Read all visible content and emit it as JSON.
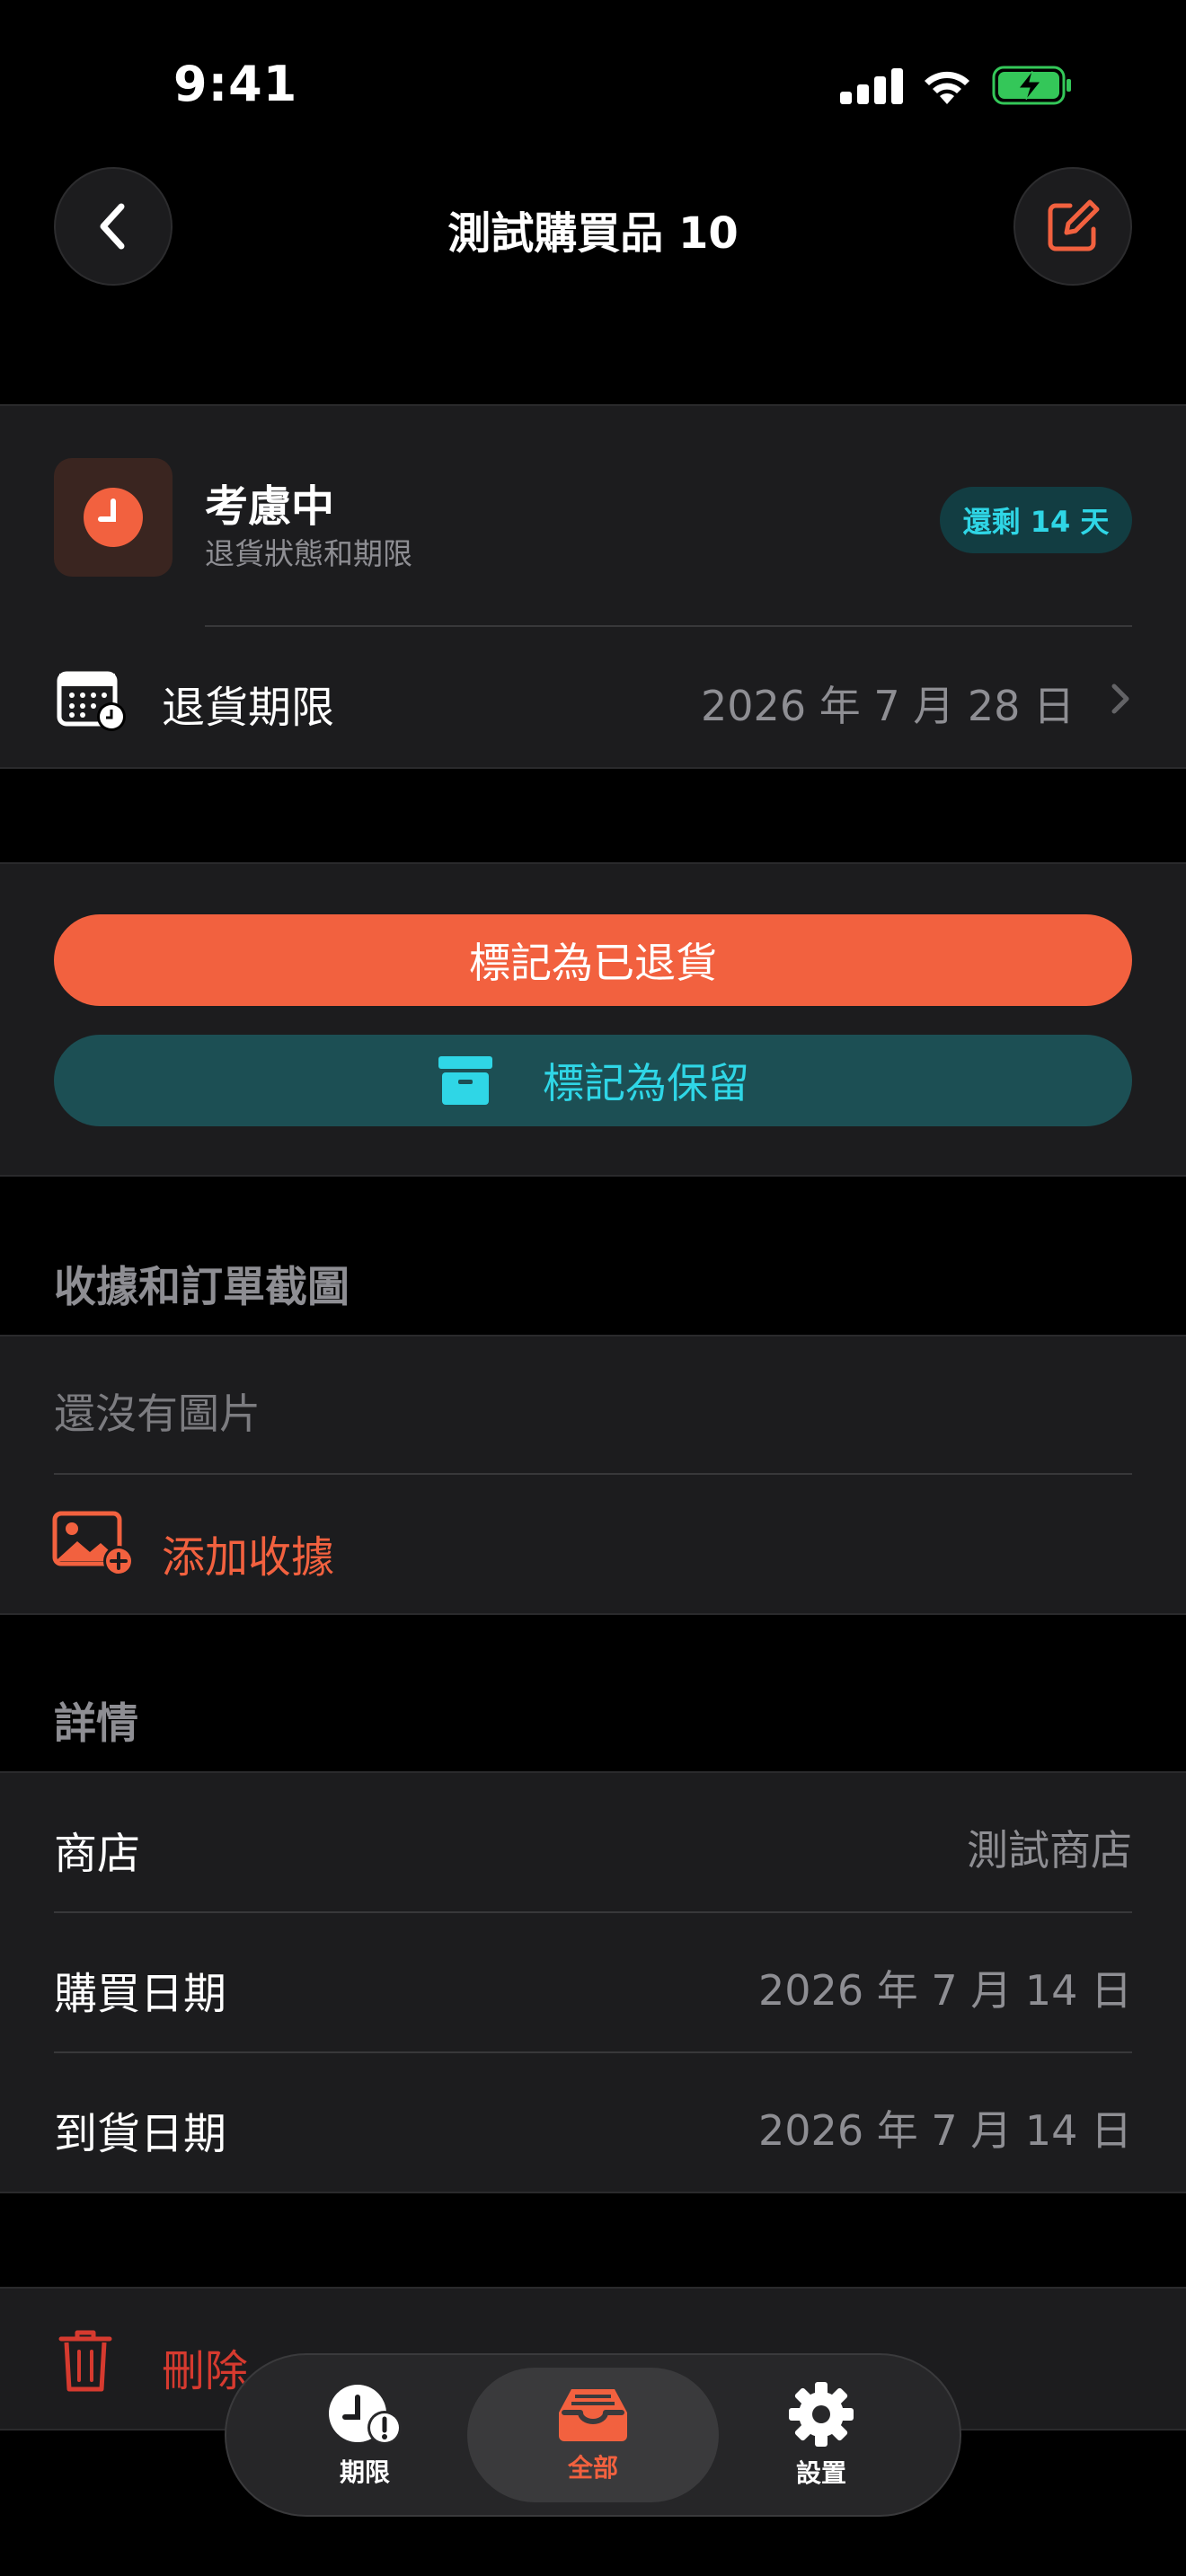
{
  "status_bar": {
    "time": "9:41"
  },
  "nav": {
    "title": "測試購買品 10",
    "back_icon": "chevron-left-icon",
    "edit_icon": "edit-icon"
  },
  "status_card": {
    "title": "考慮中",
    "subtitle": "退貨狀態和期限",
    "badge": "還剩 14 天",
    "deadline_label": "退貨期限",
    "deadline_value": "2026 年 7 月 28 日"
  },
  "actions": {
    "returned_label": "標記為已退貨",
    "keep_label": "標記為保留"
  },
  "receipts": {
    "header": "收據和訂單截圖",
    "empty_text": "還沒有圖片",
    "add_label": "添加收據"
  },
  "details": {
    "header": "詳情",
    "rows": [
      {
        "label": "商店",
        "value": "測試商店"
      },
      {
        "label": "購買日期",
        "value": "2026 年 7 月 14 日"
      },
      {
        "label": "到貨日期",
        "value": "2026 年 7 月 14 日"
      }
    ]
  },
  "delete": {
    "label": "刪除"
  },
  "tabbar": {
    "tabs": [
      {
        "label": "期限",
        "icon": "clock-alert-icon"
      },
      {
        "label": "全部",
        "icon": "tray-icon"
      },
      {
        "label": "設置",
        "icon": "gear-icon"
      }
    ],
    "selected": "全部"
  },
  "colors": {
    "accent": "#f2613f",
    "teal": "#1c4f54",
    "teal_text": "#2fd6e6",
    "delete": "#d63a2f"
  }
}
